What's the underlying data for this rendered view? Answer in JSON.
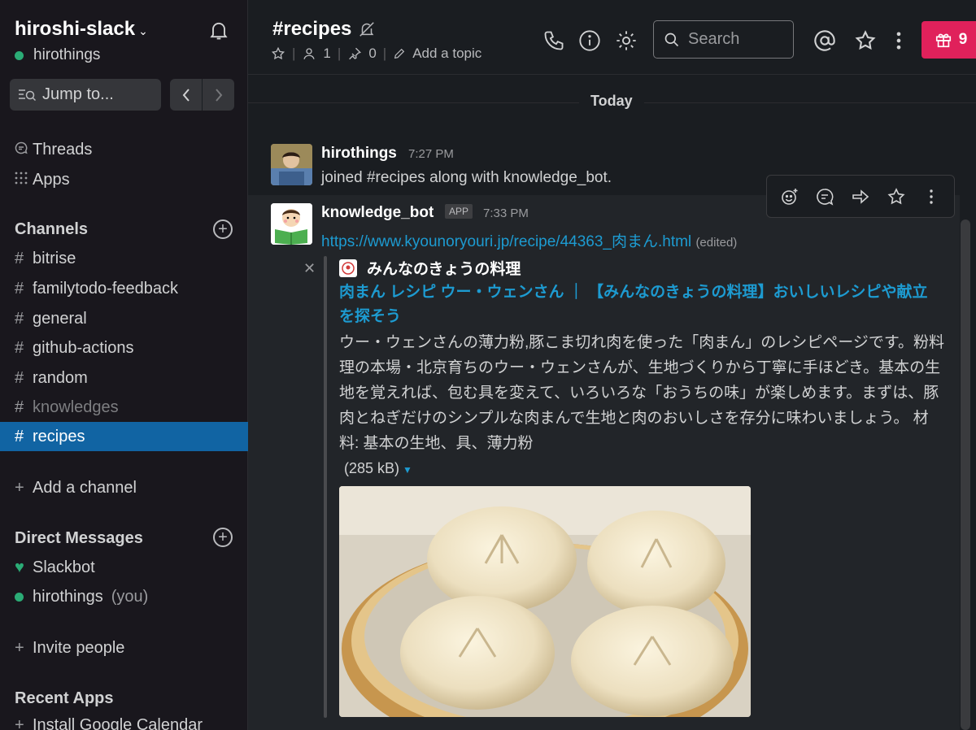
{
  "workspace": {
    "name": "hiroshi-slack",
    "user": "hirothings"
  },
  "jump": {
    "label": "Jump to..."
  },
  "sidebar": {
    "nav": [
      {
        "label": "Threads",
        "icon": "threads-icon"
      },
      {
        "label": "Apps",
        "icon": "apps-icon"
      }
    ],
    "channels_heading": "Channels",
    "channels": [
      {
        "name": "bitrise"
      },
      {
        "name": "familytodo-feedback"
      },
      {
        "name": "general"
      },
      {
        "name": "github-actions"
      },
      {
        "name": "random"
      },
      {
        "name": "knowledges",
        "muted": true
      },
      {
        "name": "recipes",
        "active": true
      }
    ],
    "add_channel": "Add a channel",
    "dm_heading": "Direct Messages",
    "dms": [
      {
        "name": "Slackbot",
        "suffix": ""
      },
      {
        "name": "hirothings",
        "suffix": "(you)"
      }
    ],
    "invite": "Invite people",
    "recent_apps_heading": "Recent Apps",
    "recent_apps": [
      "Install Google Calendar"
    ]
  },
  "header": {
    "channel": "#recipes",
    "members": "1",
    "pins": "0",
    "topic": "Add a topic",
    "search_placeholder": "Search",
    "gift_count": "9"
  },
  "messages": {
    "divider": "Today",
    "m1": {
      "user": "hirothings",
      "time": "7:27 PM",
      "text": "joined #recipes along with knowledge_bot."
    },
    "m2": {
      "user": "knowledge_bot",
      "badge": "APP",
      "time": "7:33 PM",
      "link": "https://www.kyounoryouri.jp/recipe/44363_肉まん.html",
      "edited": "(edited)",
      "attachment": {
        "site": "みんなのきょうの料理",
        "title": "肉まん レシピ ウー・ウェンさん ｜ 【みんなのきょうの料理】おいしいレシピや献立を探そう",
        "description": "ウー・ウェンさんの薄力粉,豚こま切れ肉を使った「肉まん」のレシピページです。粉料理の本場・北京育ちのウー・ウェンさんが、生地づくりから丁寧に手ほどき。基本の生地を覚えれば、包む具を変えて、いろいろな「おうちの味」が楽しめます。まずは、豚肉とねぎだけのシンプルな肉まんで生地と肉のおいしさを存分に味わいましょう。 材料: 基本の生地、具、薄力粉",
        "size": "(285 kB)"
      }
    }
  },
  "colors": {
    "accent": "#1164a3",
    "link": "#1d9bd1",
    "online": "#2bac76",
    "gift": "#e0215b"
  }
}
